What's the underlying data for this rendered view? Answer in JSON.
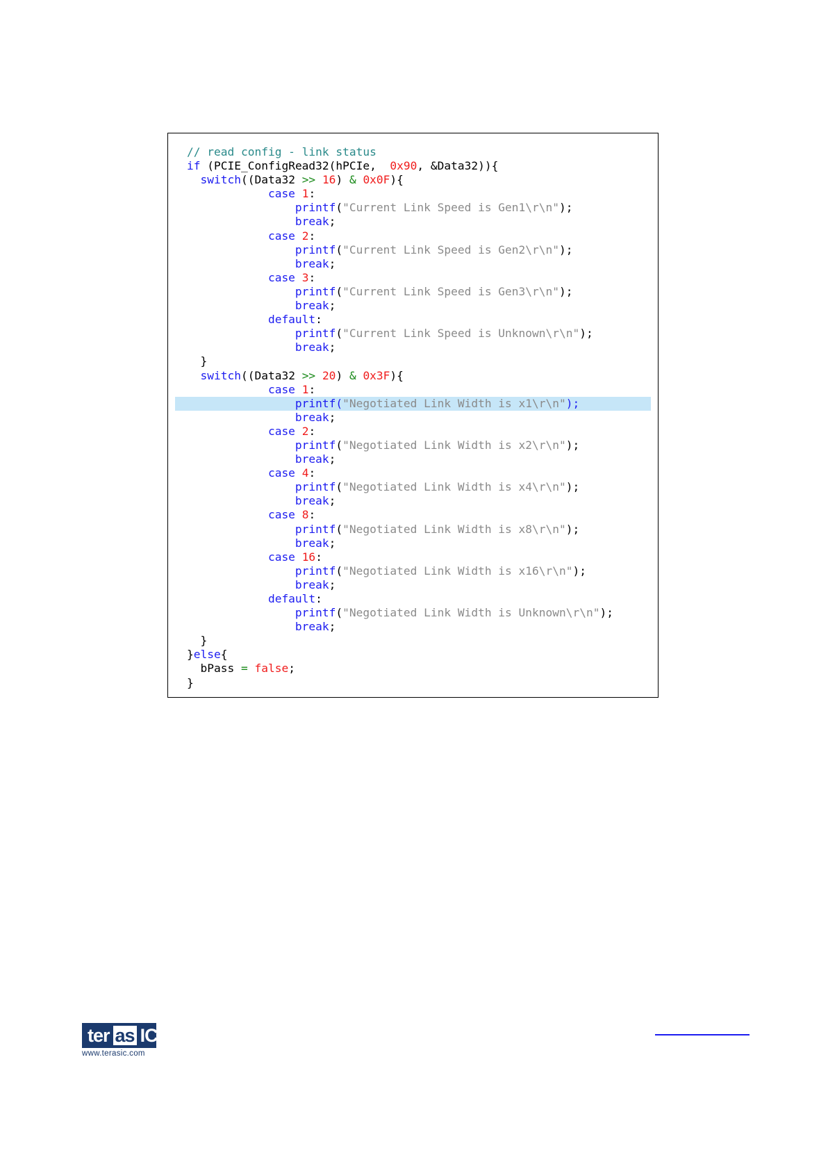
{
  "code": {
    "highlighted_line": 18,
    "lines": [
      [
        {
          "t": "// read config - link status",
          "c": "comment"
        }
      ],
      [
        {
          "t": "if",
          "c": "keyword"
        },
        {
          "t": " (PCIE_ConfigRead32(hPCIe,  ",
          "c": "plain"
        },
        {
          "t": "0x90",
          "c": "number"
        },
        {
          "t": ", &Data32)){",
          "c": "plain"
        }
      ],
      [
        {
          "t": "  switch",
          "c": "keyword"
        },
        {
          "t": "((Data32 ",
          "c": "plain"
        },
        {
          "t": ">>",
          "c": "operator"
        },
        {
          "t": " ",
          "c": "plain"
        },
        {
          "t": "16",
          "c": "number"
        },
        {
          "t": ") ",
          "c": "plain"
        },
        {
          "t": "&",
          "c": "operator"
        },
        {
          "t": " ",
          "c": "plain"
        },
        {
          "t": "0x0F",
          "c": "number"
        },
        {
          "t": "){",
          "c": "plain"
        }
      ],
      [
        {
          "t": "            case",
          "c": "keyword"
        },
        {
          "t": " ",
          "c": "plain"
        },
        {
          "t": "1",
          "c": "number"
        },
        {
          "t": ":",
          "c": "plain"
        }
      ],
      [
        {
          "t": "                printf",
          "c": "keyword"
        },
        {
          "t": "(",
          "c": "plain"
        },
        {
          "t": "\"Current Link Speed is Gen1\\r\\n\"",
          "c": "string"
        },
        {
          "t": ");",
          "c": "plain"
        }
      ],
      [
        {
          "t": "                break",
          "c": "keyword"
        },
        {
          "t": ";",
          "c": "plain"
        }
      ],
      [
        {
          "t": "            case",
          "c": "keyword"
        },
        {
          "t": " ",
          "c": "plain"
        },
        {
          "t": "2",
          "c": "number"
        },
        {
          "t": ":",
          "c": "plain"
        }
      ],
      [
        {
          "t": "                printf",
          "c": "keyword"
        },
        {
          "t": "(",
          "c": "plain"
        },
        {
          "t": "\"Current Link Speed is Gen2\\r\\n\"",
          "c": "string"
        },
        {
          "t": ");",
          "c": "plain"
        }
      ],
      [
        {
          "t": "                break",
          "c": "keyword"
        },
        {
          "t": ";",
          "c": "plain"
        }
      ],
      [
        {
          "t": "            case",
          "c": "keyword"
        },
        {
          "t": " ",
          "c": "plain"
        },
        {
          "t": "3",
          "c": "number"
        },
        {
          "t": ":",
          "c": "plain"
        }
      ],
      [
        {
          "t": "                printf",
          "c": "keyword"
        },
        {
          "t": "(",
          "c": "plain"
        },
        {
          "t": "\"Current Link Speed is Gen3\\r\\n\"",
          "c": "string"
        },
        {
          "t": ");",
          "c": "plain"
        }
      ],
      [
        {
          "t": "                break",
          "c": "keyword"
        },
        {
          "t": ";",
          "c": "plain"
        }
      ],
      [
        {
          "t": "            default",
          "c": "keyword"
        },
        {
          "t": ":",
          "c": "plain"
        }
      ],
      [
        {
          "t": "                printf",
          "c": "keyword"
        },
        {
          "t": "(",
          "c": "plain"
        },
        {
          "t": "\"Current Link Speed is Unknown\\r\\n\"",
          "c": "string"
        },
        {
          "t": ");",
          "c": "plain"
        }
      ],
      [
        {
          "t": "                break",
          "c": "keyword"
        },
        {
          "t": ";",
          "c": "plain"
        }
      ],
      [
        {
          "t": "  }",
          "c": "plain"
        }
      ],
      [
        {
          "t": "  switch",
          "c": "keyword"
        },
        {
          "t": "((Data32 ",
          "c": "plain"
        },
        {
          "t": ">>",
          "c": "operator"
        },
        {
          "t": " ",
          "c": "plain"
        },
        {
          "t": "20",
          "c": "number"
        },
        {
          "t": ") ",
          "c": "plain"
        },
        {
          "t": "&",
          "c": "operator"
        },
        {
          "t": " ",
          "c": "plain"
        },
        {
          "t": "0x3F",
          "c": "number"
        },
        {
          "t": "){",
          "c": "plain"
        }
      ],
      [
        {
          "t": "            case",
          "c": "keyword"
        },
        {
          "t": " ",
          "c": "plain"
        },
        {
          "t": "1",
          "c": "number"
        },
        {
          "t": ":",
          "c": "plain"
        }
      ],
      [
        {
          "t": "                printf",
          "c": "keyword"
        },
        {
          "t": "(",
          "c": "keyword"
        },
        {
          "t": "\"Negotiated Link Width is x1\\r\\n\"",
          "c": "string"
        },
        {
          "t": ");",
          "c": "keyword"
        }
      ],
      [
        {
          "t": "                break",
          "c": "keyword"
        },
        {
          "t": ";",
          "c": "plain"
        }
      ],
      [
        {
          "t": "            case",
          "c": "keyword"
        },
        {
          "t": " ",
          "c": "plain"
        },
        {
          "t": "2",
          "c": "number"
        },
        {
          "t": ":",
          "c": "plain"
        }
      ],
      [
        {
          "t": "                printf",
          "c": "keyword"
        },
        {
          "t": "(",
          "c": "plain"
        },
        {
          "t": "\"Negotiated Link Width is x2\\r\\n\"",
          "c": "string"
        },
        {
          "t": ");",
          "c": "plain"
        }
      ],
      [
        {
          "t": "                break",
          "c": "keyword"
        },
        {
          "t": ";",
          "c": "plain"
        }
      ],
      [
        {
          "t": "            case",
          "c": "keyword"
        },
        {
          "t": " ",
          "c": "plain"
        },
        {
          "t": "4",
          "c": "number"
        },
        {
          "t": ":",
          "c": "plain"
        }
      ],
      [
        {
          "t": "                printf",
          "c": "keyword"
        },
        {
          "t": "(",
          "c": "plain"
        },
        {
          "t": "\"Negotiated Link Width is x4\\r\\n\"",
          "c": "string"
        },
        {
          "t": ");",
          "c": "plain"
        }
      ],
      [
        {
          "t": "                break",
          "c": "keyword"
        },
        {
          "t": ";",
          "c": "plain"
        }
      ],
      [
        {
          "t": "            case",
          "c": "keyword"
        },
        {
          "t": " ",
          "c": "plain"
        },
        {
          "t": "8",
          "c": "number"
        },
        {
          "t": ":",
          "c": "plain"
        }
      ],
      [
        {
          "t": "                printf",
          "c": "keyword"
        },
        {
          "t": "(",
          "c": "plain"
        },
        {
          "t": "\"Negotiated Link Width is x8\\r\\n\"",
          "c": "string"
        },
        {
          "t": ");",
          "c": "plain"
        }
      ],
      [
        {
          "t": "                break",
          "c": "keyword"
        },
        {
          "t": ";",
          "c": "plain"
        }
      ],
      [
        {
          "t": "            case",
          "c": "keyword"
        },
        {
          "t": " ",
          "c": "plain"
        },
        {
          "t": "16",
          "c": "number"
        },
        {
          "t": ":",
          "c": "plain"
        }
      ],
      [
        {
          "t": "                printf",
          "c": "keyword"
        },
        {
          "t": "(",
          "c": "plain"
        },
        {
          "t": "\"Negotiated Link Width is x16\\r\\n\"",
          "c": "string"
        },
        {
          "t": ");",
          "c": "plain"
        }
      ],
      [
        {
          "t": "                break",
          "c": "keyword"
        },
        {
          "t": ";",
          "c": "plain"
        }
      ],
      [
        {
          "t": "            default",
          "c": "keyword"
        },
        {
          "t": ":",
          "c": "plain"
        }
      ],
      [
        {
          "t": "                printf",
          "c": "keyword"
        },
        {
          "t": "(",
          "c": "plain"
        },
        {
          "t": "\"Negotiated Link Width is Unknown\\r\\n\"",
          "c": "string"
        },
        {
          "t": ");",
          "c": "plain"
        }
      ],
      [
        {
          "t": "                break",
          "c": "keyword"
        },
        {
          "t": ";",
          "c": "plain"
        }
      ],
      [
        {
          "t": "  }",
          "c": "plain"
        }
      ],
      [
        {
          "t": "}",
          "c": "plain"
        },
        {
          "t": "else",
          "c": "keyword"
        },
        {
          "t": "{",
          "c": "plain"
        }
      ],
      [
        {
          "t": "  bPass ",
          "c": "plain"
        },
        {
          "t": "=",
          "c": "operator"
        },
        {
          "t": " ",
          "c": "plain"
        },
        {
          "t": "false",
          "c": "number"
        },
        {
          "t": ";",
          "c": "plain"
        }
      ],
      [
        {
          "t": "}",
          "c": "plain"
        }
      ]
    ]
  },
  "footer": {
    "logo": {
      "ter": "ter",
      "as": "as",
      "ic": "IC",
      "url": "www.terasic.com"
    },
    "link_color": "#1c1cf0"
  }
}
